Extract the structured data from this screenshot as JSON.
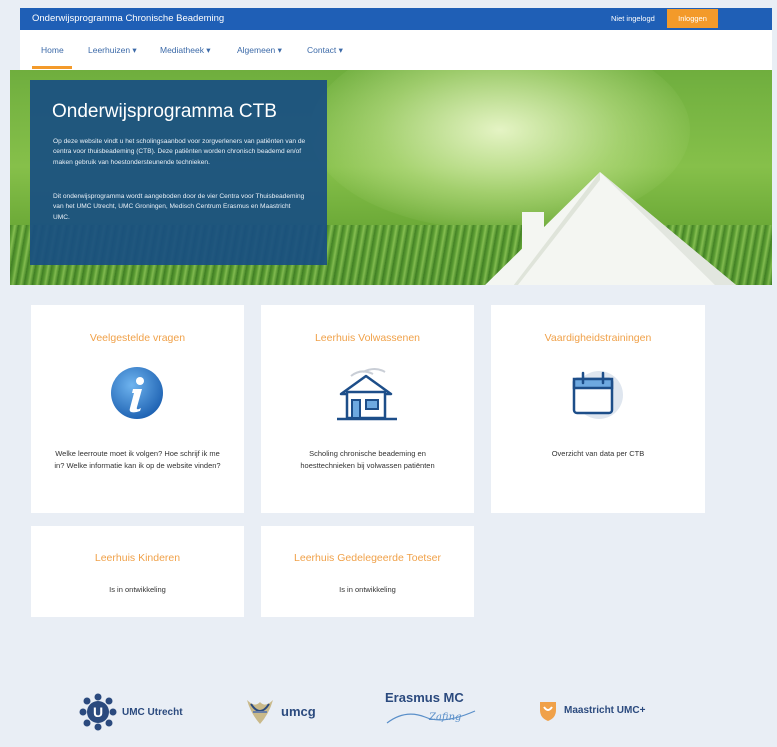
{
  "header": {
    "site_title": "Onderwijsprogramma Chronische Beademing",
    "login_status": "Niet ingelogd",
    "login_button": "Inloggen"
  },
  "nav": {
    "items": [
      "Home",
      "Leerhuizen ▾",
      "Mediatheek ▾",
      "Algemeen ▾",
      "Contact ▾"
    ]
  },
  "hero": {
    "title": "Onderwijsprogramma CTB",
    "paragraph1": "Op deze website vindt u het scholingsaanbod voor zorgverleners van patiënten van de centra voor thuisbeademing (CTB). Deze patiënten worden chronisch beademd en/of maken gebruik van hoestondersteunende technieken.",
    "paragraph2": "Dit onderwijsprogramma wordt aangeboden door de vier Centra voor Thuisbeademing van het UMC Utrecht, UMC Groningen, Medisch Centrum Erasmus en Maastricht UMC."
  },
  "cards": [
    {
      "title": "Veelgestelde vragen",
      "icon": "info-icon",
      "text": "Welke leerroute moet ik volgen? Hoe schrijf ik me in? Welke informatie kan ik op de website vinden?"
    },
    {
      "title": "Leerhuis Volwassenen",
      "icon": "house-icon",
      "text": "Scholing chronische beademing en hoesttechnieken bij volwassen patiënten"
    },
    {
      "title": "Vaardigheidstrainingen",
      "icon": "calendar-icon",
      "text": "Overzicht van data per CTB"
    },
    {
      "title": "Leerhuis Kinderen",
      "text": "Is in ontwikkeling"
    },
    {
      "title": "Leerhuis Gedelegeerde Toetser",
      "text": "Is in ontwikkeling"
    }
  ],
  "footer": {
    "logos": [
      "UMC Utrecht",
      "umcg",
      "Erasmus MC",
      "Maastricht UMC+"
    ],
    "erasmus_tagline": "Zafing"
  },
  "colors": {
    "brand_blue": "#1f5fb6",
    "accent_orange": "#f39a2a",
    "hero_panel": "#184e82",
    "card_title": "#f0a149",
    "page_bg": "#e9eef5"
  }
}
